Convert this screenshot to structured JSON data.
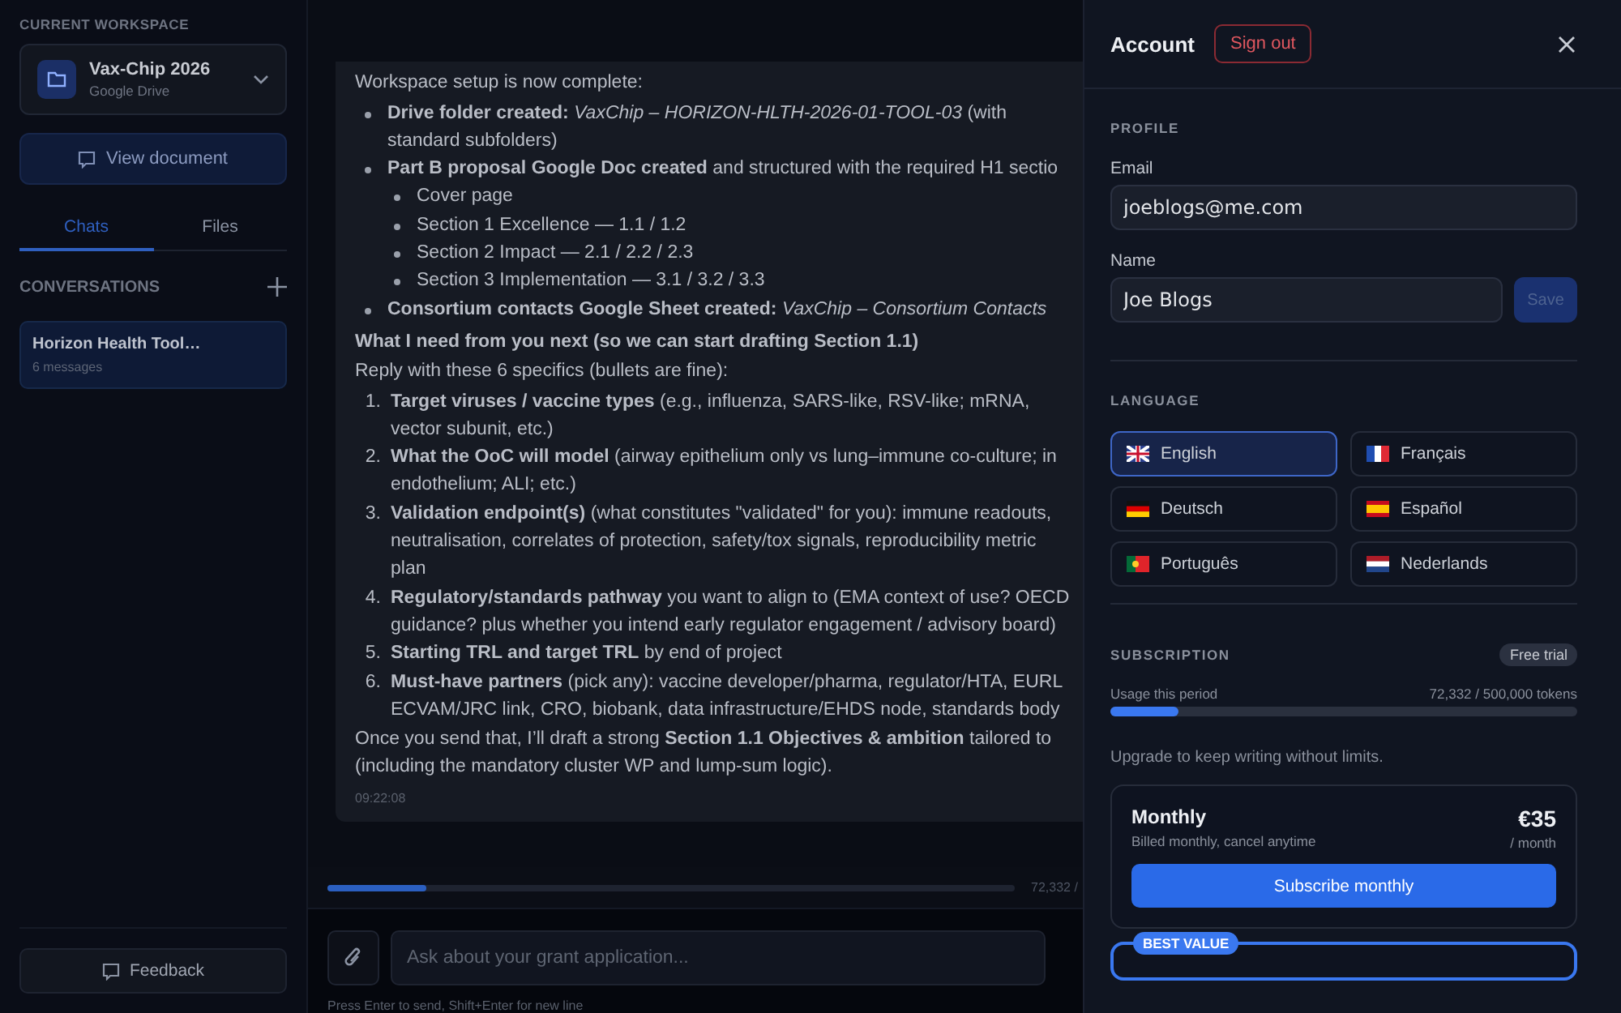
{
  "sidebar": {
    "workspace_label": "CURRENT WORKSPACE",
    "workspace": {
      "name": "Vax-Chip 2026",
      "provider": "Google Drive"
    },
    "view_button": "View document",
    "tabs": [
      {
        "label": "Chats",
        "selected": true
      },
      {
        "label": "Files",
        "selected": false
      }
    ],
    "conversations_label": "CONVERSATIONS",
    "conversations": [
      {
        "title": "Horizon Health Tool…",
        "meta": "6 messages",
        "selected": true
      }
    ],
    "feedback": "Feedback"
  },
  "chat": {
    "message": {
      "intro": "Workspace setup is now complete:",
      "bullets": [
        {
          "text": "**Drive folder created:** *VaxChip – HORIZON-HLTH-2026-01-TOOL-03* (with standard subfolders)"
        },
        {
          "text": "**Part B proposal Google Doc created** and structured with the required H1 sectio",
          "children": [
            "Cover page",
            "Section 1 Excellence — 1.1 / 1.2",
            "Section 2 Impact — 2.1 / 2.2 / 2.3",
            "Section 3 Implementation — 3.1 / 3.2 / 3.3"
          ]
        },
        {
          "text": "**Consortium contacts Google Sheet created:** *VaxChip – Consortium Contacts*"
        }
      ],
      "heading": "What I need from you next (so we can start drafting Section 1.1)",
      "lead": "Reply with these 6 specifics (bullets are fine):",
      "numbered": [
        {
          "marker": "1.",
          "text": "**Target viruses / vaccine types** (e.g., influenza, SARS-like, RSV-like; mRNA, vector subunit, etc.)"
        },
        {
          "marker": "2.",
          "text": "**What the OoC will model** (airway epithelium only vs lung–immune co-culture; in endothelium; ALI; etc.)"
        },
        {
          "marker": "3.",
          "text": "**Validation endpoint(s)** (what constitutes \"validated\" for you): immune readouts, neutralisation, correlates of protection, safety/tox signals, reproducibility metric plan"
        },
        {
          "marker": "4.",
          "text": "**Regulatory/standards pathway** you want to align to (EMA context of use? OECD guidance? plus whether you intend early regulator engagement / advisory board)"
        },
        {
          "marker": "5.",
          "text": "**Starting TRL and target TRL** by end of project"
        },
        {
          "marker": "6.",
          "text": "**Must-have partners** (pick any): vaccine developer/pharma, regulator/HTA, EURL ECVAM/JRC link, CRO, biobank, data infrastructure/EHDS node, standards body"
        }
      ],
      "outro": "Once you send that, I’ll draft a strong **Section 1.1 Objectives & ambition** tailored to (including the mandatory cluster WP and lump-sum logic).",
      "time": "09:22:08"
    },
    "usage": {
      "level": 0.145,
      "reading": "72,332 /"
    },
    "composer": {
      "placeholder": "Ask about your grant application...",
      "hint": "Press Enter to send, Shift+Enter for new line"
    }
  },
  "panel": {
    "title": "Account",
    "sign_out": "Sign out",
    "profile_label": "PROFILE",
    "email_label": "Email",
    "email": "joeblogs@me.com",
    "name_label": "Name",
    "name": "Joe Blogs",
    "save": {
      "label": "Save",
      "disabled": true
    },
    "language_label": "LANGUAGE",
    "languages": [
      {
        "label": "English",
        "kind": "gb",
        "selected": true
      },
      {
        "label": "Français",
        "kind": "fr",
        "selected": false
      },
      {
        "label": "Deutsch",
        "kind": "de",
        "selected": false
      },
      {
        "label": "Español",
        "kind": "es",
        "selected": false
      },
      {
        "label": "Português",
        "kind": "pt",
        "selected": false
      },
      {
        "label": "Nederlands",
        "kind": "nl",
        "selected": false
      }
    ],
    "subscription_label": "SUBSCRIPTION",
    "plan_badge": "Free trial",
    "usage_label": "Usage this period",
    "usage_reading": "72,332 / 500,000 tokens",
    "level": 0.145,
    "upgrade_text": "Upgrade to keep writing without limits.",
    "plans": [
      {
        "name": "Monthly",
        "billing": "Billed monthly, cancel anytime",
        "price": "€35",
        "period": "/ month",
        "button": "Subscribe monthly"
      },
      {
        "badge": "BEST VALUE"
      }
    ]
  }
}
